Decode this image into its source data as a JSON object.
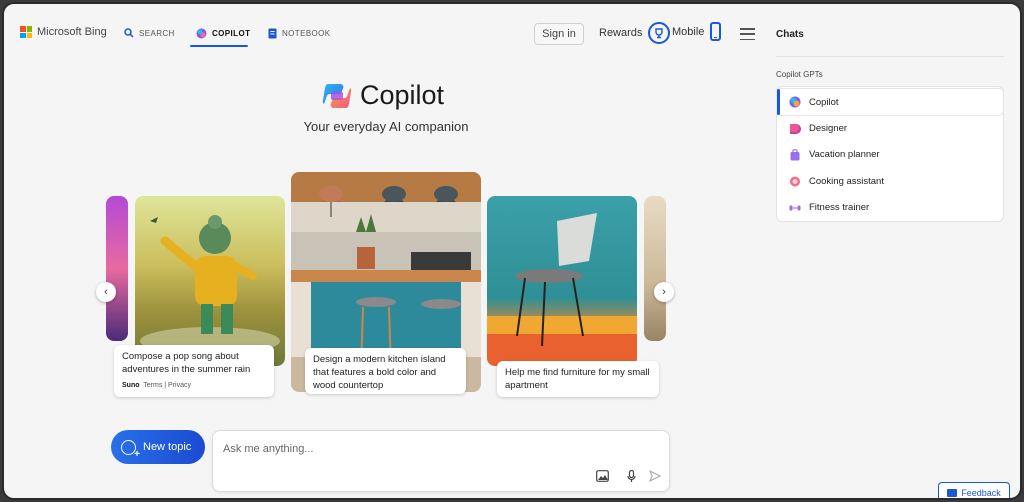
{
  "header": {
    "brand": "Microsoft Bing",
    "tabs": [
      {
        "label": "SEARCH",
        "icon": "search-icon"
      },
      {
        "label": "COPILOT",
        "icon": "copilot-icon",
        "active": true
      },
      {
        "label": "NOTEBOOK",
        "icon": "notebook-icon"
      }
    ],
    "signin_label": "Sign in",
    "rewards_label": "Rewards",
    "mobile_label": "Mobile",
    "accent_color": "#1a58d6"
  },
  "hero": {
    "title": "Copilot",
    "subtitle": "Your everyday AI companion"
  },
  "carousel": {
    "cards": [
      {
        "caption": "Compose a pop song about adventures in the summer rain",
        "brand": "Suno",
        "links": "Terms | Privacy"
      },
      {
        "caption": "Design a modern kitchen island that features a bold color and wood countertop"
      },
      {
        "caption": "Help me find furniture for my small apartment"
      }
    ]
  },
  "composer": {
    "new_topic_label": "New topic",
    "placeholder": "Ask me anything..."
  },
  "panel": {
    "title": "Chats",
    "gpts_label": "Copilot GPTs",
    "gpts": [
      {
        "label": "Copilot",
        "icon": "copilot-icon",
        "active": true
      },
      {
        "label": "Designer",
        "icon": "designer-icon"
      },
      {
        "label": "Vacation planner",
        "icon": "vacation-planner-icon"
      },
      {
        "label": "Cooking assistant",
        "icon": "cooking-assistant-icon"
      },
      {
        "label": "Fitness trainer",
        "icon": "fitness-trainer-icon"
      }
    ],
    "feedback_label": "Feedback"
  }
}
